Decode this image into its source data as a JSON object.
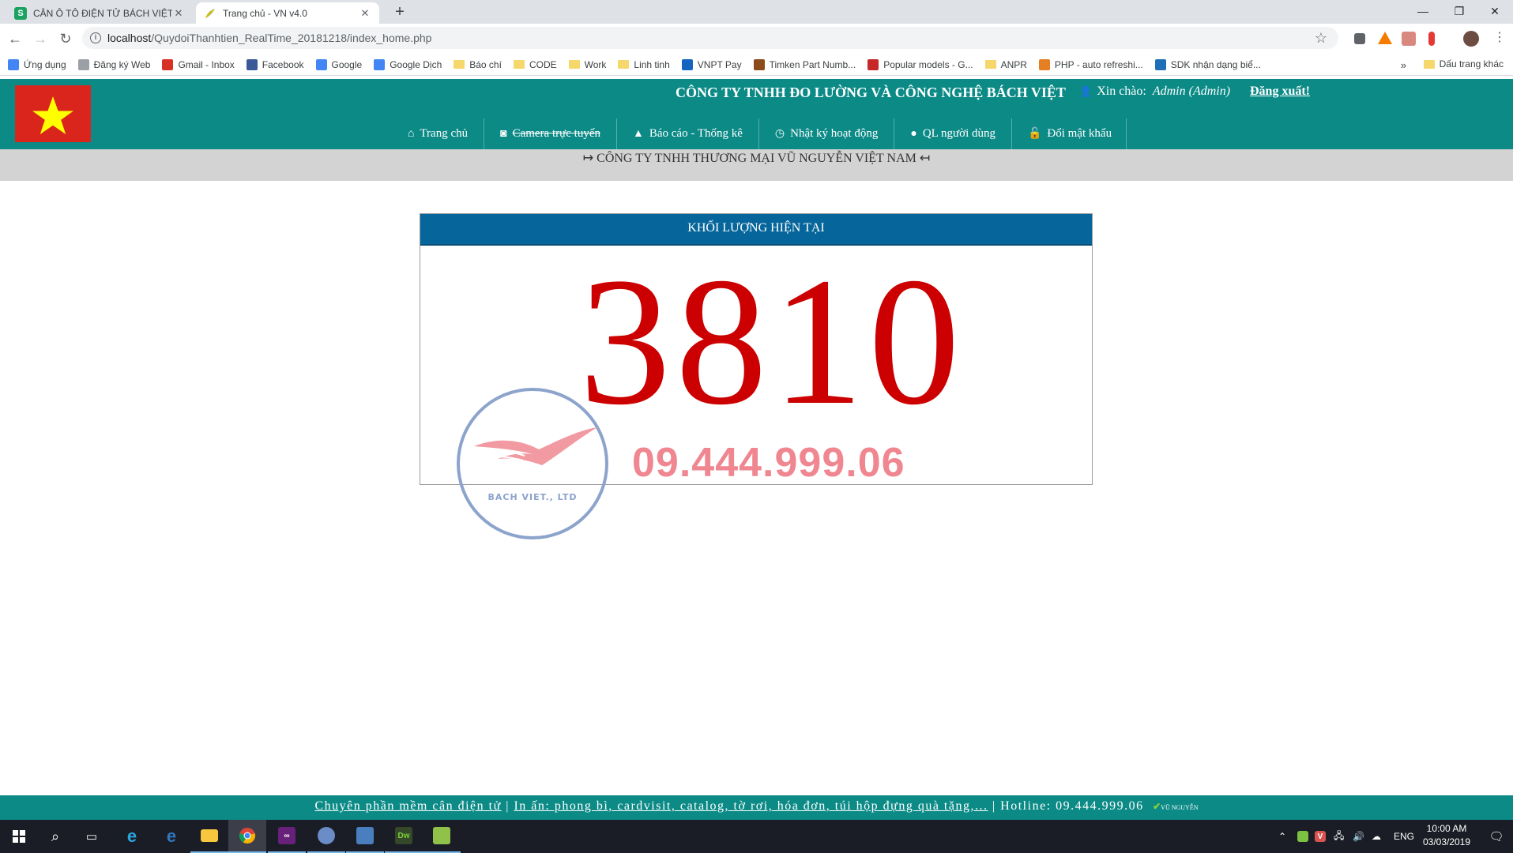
{
  "browser": {
    "tabs": [
      {
        "title": "CÂN Ô TÔ ĐIỆN TỬ BÁCH VIỆT |",
        "favicon": "S",
        "active": false
      },
      {
        "title": "Trang chủ - VN v4.0",
        "favicon": "leaf",
        "active": true
      }
    ],
    "new_tab_label": "+",
    "url_host": "localhost",
    "url_path": "/QuydoiThanhtien_RealTime_20181218/index_home.php",
    "bookmarks": [
      {
        "label": "Ứng dụng",
        "icon": "apps-grid-icon"
      },
      {
        "label": "Đăng ký Web",
        "icon": "page-icon"
      },
      {
        "label": "Gmail - Inbox",
        "icon": "gmail-icon"
      },
      {
        "label": "Facebook",
        "icon": "facebook-icon"
      },
      {
        "label": "Google",
        "icon": "google-icon"
      },
      {
        "label": "Google Dịch",
        "icon": "translate-icon"
      },
      {
        "label": "Báo chí",
        "icon": "folder-icon"
      },
      {
        "label": "CODE",
        "icon": "folder-icon"
      },
      {
        "label": "Work",
        "icon": "folder-icon"
      },
      {
        "label": "Linh tinh",
        "icon": "folder-icon"
      },
      {
        "label": "VNPT Pay",
        "icon": "vnpt-icon"
      },
      {
        "label": "Timken Part Numb...",
        "icon": "timken-icon"
      },
      {
        "label": "Popular models - G...",
        "icon": "gc-icon"
      },
      {
        "label": "ANPR",
        "icon": "folder-icon"
      },
      {
        "label": "PHP - auto refreshi...",
        "icon": "php-icon"
      },
      {
        "label": "SDK nhận dạng biể...",
        "icon": "sdk-icon"
      }
    ],
    "bookmarks_more": "»",
    "other_bookmarks": "Dấu trang khác"
  },
  "header": {
    "company": "CÔNG TY TNHH ĐO LƯỜNG VÀ CÔNG NGHỆ BÁCH VIỆT",
    "greeting": "Xin chào:",
    "username": "Admin (Admin)",
    "logout": "Đăng xuất!",
    "menu": [
      {
        "label": "Trang chủ",
        "icon": "⌂",
        "name": "home"
      },
      {
        "label": "Camera trực tuyến",
        "icon": "◙",
        "name": "camera"
      },
      {
        "label": "Báo cáo - Thống kê",
        "icon": "▲",
        "name": "report"
      },
      {
        "label": "Nhật ký hoạt động",
        "icon": "◷",
        "name": "log"
      },
      {
        "label": "QL người dùng",
        "icon": "●",
        "name": "users"
      },
      {
        "label": "Đổi mật khẩu",
        "icon": "🔓",
        "name": "password"
      }
    ]
  },
  "marquee": "↦ CÔNG TY TNHH THƯƠNG MẠI VŨ NGUYỄN VIỆT NAM ↤",
  "panel": {
    "title": "KHỐI LƯỢNG HIỆN TẠI",
    "weight": "3810"
  },
  "watermark": {
    "brand": "BACH VIET., LTD",
    "phone": "09.444.999.06"
  },
  "footer": {
    "link1": "Chuyên phần mềm cân điện tử",
    "separator": "|",
    "link2": "In ấn: phong bì, cardvisit, catalog, tờ rơi, hóa đơn, túi hộp đựng quà tặng,...",
    "hotline": "| Hotline: 09.444.999.06",
    "logo_text": "VŨ NGUYỄN"
  },
  "taskbar": {
    "lang": "ENG",
    "time": "10:00 AM",
    "date": "03/03/2019"
  }
}
